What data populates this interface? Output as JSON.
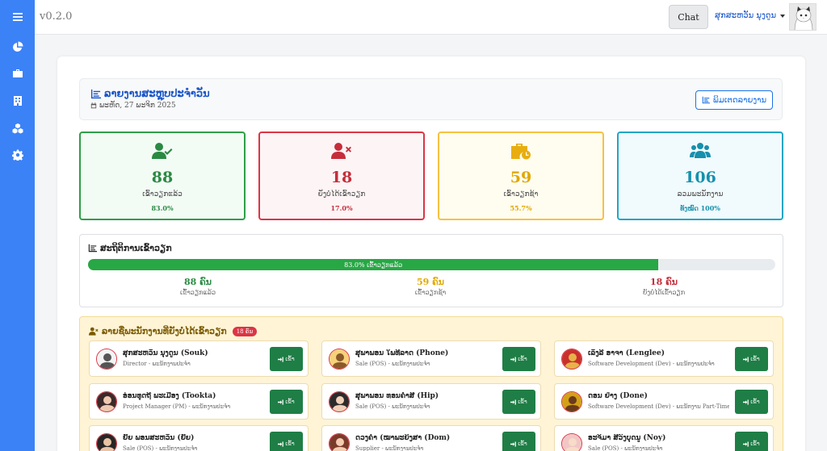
{
  "app": {
    "version": "v0.2.0"
  },
  "sidebar": {
    "items": [
      {
        "icon": "menu-icon"
      },
      {
        "icon": "pie-chart-icon"
      },
      {
        "icon": "briefcase-icon"
      },
      {
        "icon": "building-icon"
      },
      {
        "icon": "cubes-icon"
      },
      {
        "icon": "gear-icon"
      }
    ]
  },
  "topbar": {
    "chat_label": "Chat",
    "user_name": "ສຸກສະຫວັນ ນຸງດູນ"
  },
  "report": {
    "title": "ລາຍງານສະຫຼຸບປະຈຳວັນ",
    "date": "ພະຫັດ, 27 ພະຈິກ 2025",
    "print_label": "ພິມເຕດລາຍງານ"
  },
  "stats": [
    {
      "key": "checked_in",
      "value": "88",
      "label": "ເຂົ້າວຽກແລ້ວ",
      "percent": "83.0%",
      "color": "#2a8a43"
    },
    {
      "key": "not_checked_in",
      "value": "18",
      "label": "ຍັງບໍ່ໄດ້ເຂົ້າວຽກ",
      "percent": "17.0%",
      "color": "#c62d3a"
    },
    {
      "key": "late",
      "value": "59",
      "label": "ເຂົ້າວຽກຊ້າ",
      "percent": "55.7%",
      "color": "#e0a800"
    },
    {
      "key": "total",
      "value": "106",
      "label": "ລວມພະນັກງານ",
      "percent": "ທັງໝົດ 100%",
      "color": "#1590ad"
    }
  ],
  "attendance": {
    "title": "ສະຖິຕິການເຂົ້າວຽກ",
    "progress_fraction": 0.83,
    "progress_label": "83.0% ເຂົ້າວຽກແລ້ວ",
    "summary": [
      {
        "value": "88 ຄົນ",
        "label": "ເຂົ້າວຽກແລ້ວ",
        "color": "#2a8a43"
      },
      {
        "value": "59 ຄົນ",
        "label": "ເຂົ້າວຽກຊ້າ",
        "color": "#e0a800"
      },
      {
        "value": "18 ຄົນ",
        "label": "ຍັງບໍ່ໄດ້ເຂົ້າວຽກ",
        "color": "#c62d3a"
      }
    ]
  },
  "absent": {
    "title": "ລາຍຊື່ພະນັກງານທີ່ຍັງບໍ່ໄດ້ເຂົ້າວຽກ",
    "count_badge": "18 ຄົນ",
    "checkin_label": "ເຂົ້າ",
    "employees": [
      {
        "name": "ສຸກສະຫວັນ ນຸງດູນ (Souk)",
        "role": "Director - ພະນັກງານປະຈຳ"
      },
      {
        "name": "ສຸພາພອນ ໃພທີລາດ (Phone)",
        "role": "Sale (POS) - ພະນັກງານປະຈຳ"
      },
      {
        "name": "ເລັງລີ ອາຈາ (Lenglee)",
        "role": "Software Development (Dev) - ພະນັກງານປະຈຳ"
      },
      {
        "name": "ອ່ອນທຸດຖີ ພະເມືອງ (Tookta)",
        "role": "Project Manager (PM) - ພະນັກງານປະຈຳ"
      },
      {
        "name": "ສຸພາພອນ ທອນຄຳສີ (Hip)",
        "role": "Sale (POS) - ພະນັກງານປະຈຳ"
      },
      {
        "name": "ດອນ ຢ່າງ (Done)",
        "role": "Software Development (Dev) - ພະນັກງານ Part-Time"
      },
      {
        "name": "ຢົ້ຍ ພອນສະຫວັນ (ຢົ້ຍ)",
        "role": "Sale (POS) - ພະນັກງານປະຈຳ"
      },
      {
        "name": "ດວງຄຳ (ໝາພະຍິງສາ (Dom)",
        "role": "Supplier - ພະນັກງານປະຈຳ"
      },
      {
        "name": "ອະຈິມາ ສີວົງບຸດນູ (Noy)",
        "role": "Sale (POS) - ພະນັກງານປະຈຳ"
      }
    ]
  }
}
